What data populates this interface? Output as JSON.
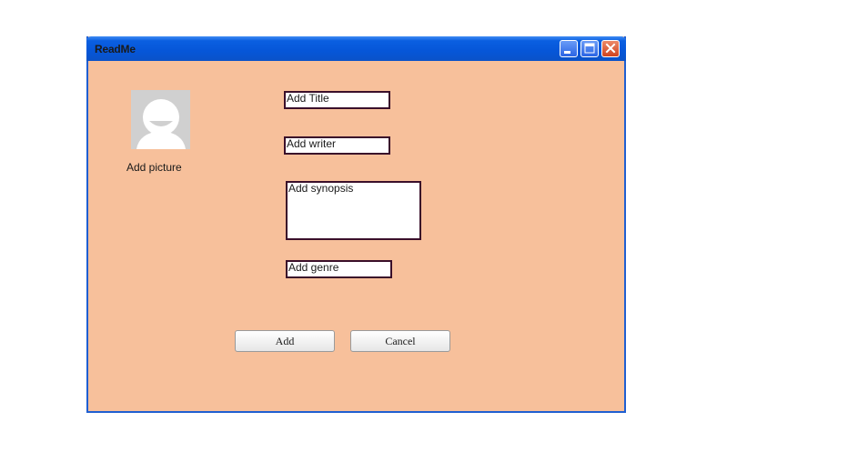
{
  "window": {
    "title": "ReadMe",
    "controls": {
      "minimize_icon": "minimize-icon",
      "maximize_icon": "maximize-icon",
      "close_icon": "close-icon"
    }
  },
  "form": {
    "picture": {
      "icon": "avatar-placeholder-icon",
      "label": "Add picture"
    },
    "title_placeholder": "Add Title",
    "writer_placeholder": "Add writer",
    "synopsis_placeholder": "Add synopsis",
    "genre_placeholder": "Add genre"
  },
  "buttons": {
    "add_label": "Add",
    "cancel_label": "Cancel"
  },
  "colors": {
    "window_background": "#f7c09b",
    "titlebar": "#0656d8",
    "field_border": "#3a0f2a",
    "close_button": "#d0431e"
  }
}
